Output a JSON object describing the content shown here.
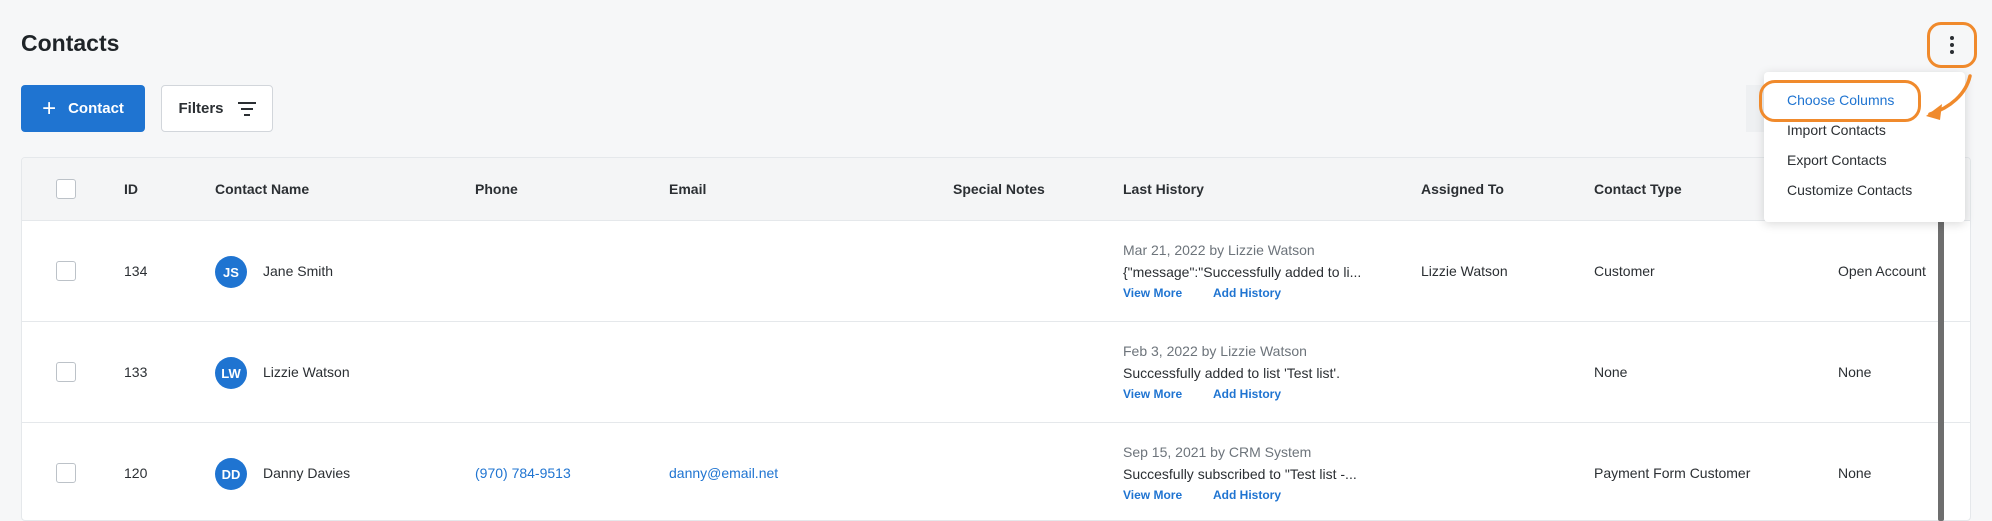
{
  "page": {
    "title": "Contacts"
  },
  "toolbar": {
    "add_label": "Contact",
    "filters_label": "Filters"
  },
  "columns": {
    "id": "ID",
    "name": "Contact Name",
    "phone": "Phone",
    "email": "Email",
    "notes": "Special Notes",
    "history": "Last History",
    "assigned": "Assigned To",
    "type": "Contact Type"
  },
  "rows": [
    {
      "id": "134",
      "initials": "JS",
      "name": "Jane Smith",
      "phone": "",
      "email": "",
      "notes": "",
      "history_date": "Mar 21, 2022 by Lizzie Watson",
      "history_msg": "{\"message\":\"Successfully added to li...",
      "view_more": "View More",
      "add_history": "Add History",
      "assigned": "Lizzie Watson",
      "type": "Customer",
      "extra": "Open Account"
    },
    {
      "id": "133",
      "initials": "LW",
      "name": "Lizzie Watson",
      "phone": "",
      "email": "",
      "notes": "",
      "history_date": "Feb 3, 2022 by Lizzie Watson",
      "history_msg": "Successfully added to list 'Test list'.",
      "view_more": "View More",
      "add_history": "Add History",
      "assigned": "",
      "type": "None",
      "extra": "None"
    },
    {
      "id": "120",
      "initials": "DD",
      "name": "Danny Davies",
      "phone": "(970) 784-9513",
      "email": "danny@email.net",
      "notes": "",
      "history_date": "Sep 15, 2021 by CRM System",
      "history_msg": "Succesfully subscribed to \"Test list -...",
      "view_more": "View More",
      "add_history": "Add History",
      "assigned": "",
      "type": "Payment Form Customer",
      "extra": "None"
    }
  ],
  "menu": {
    "items": [
      "Choose Columns",
      "Import Contacts",
      "Export Contacts",
      "Customize Contacts"
    ],
    "active_index": 0
  },
  "icons": {
    "more": "vertical-ellipsis-icon",
    "add": "plus-icon",
    "filter": "filter-lines-icon",
    "annotation": "curved-arrow-icon"
  },
  "colors": {
    "accent": "#1f74d1",
    "highlight": "#f08a2c",
    "background": "#f6f7f8"
  }
}
